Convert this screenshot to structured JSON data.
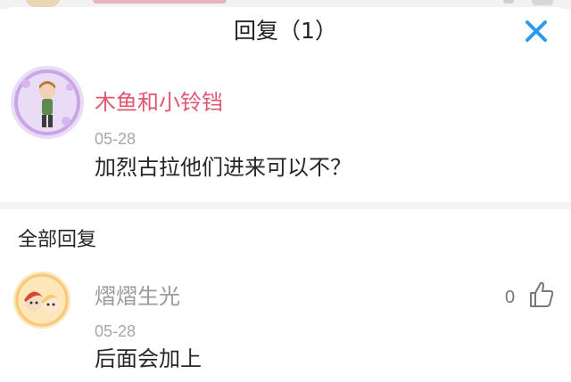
{
  "header": {
    "title": "回复（1）",
    "close_icon": "close-icon"
  },
  "colors": {
    "accent": "#2b9af3",
    "author_name": "#e0566f",
    "muted_name": "#9a9a9a"
  },
  "original_comment": {
    "author": "木鱼和小铃铛",
    "date": "05-28",
    "text": "加烈古拉他们进来可以不？",
    "avatar_icon": "anime-avatar"
  },
  "replies_section": {
    "title": "全部回复",
    "items": [
      {
        "author": "熠熠生光",
        "date": "05-28",
        "text": "后面会加上",
        "likes": "0",
        "like_icon": "thumbs-up-icon",
        "avatar_icon": "anime-couple-avatar"
      }
    ]
  }
}
